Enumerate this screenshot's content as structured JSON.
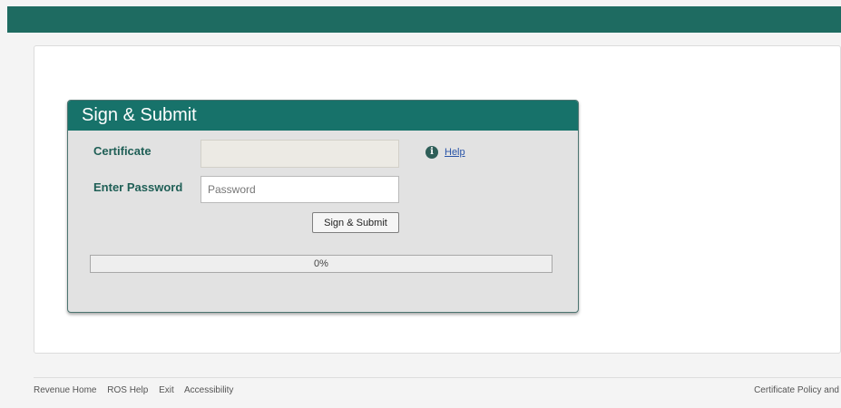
{
  "colors": {
    "header_bar": "#1e6b61",
    "panel_header": "#17726a",
    "label_text": "#1f5f56",
    "link": "#2a55a8"
  },
  "panel": {
    "title": "Sign & Submit",
    "certificate_label": "Certificate",
    "certificate_value": "",
    "password_label": "Enter Password",
    "password_value": "",
    "password_placeholder": "Password",
    "help_icon": "info-circle-icon",
    "help_label": "Help",
    "submit_label": "Sign & Submit",
    "progress_percent": 0,
    "progress_text": "0%"
  },
  "footer": {
    "links": [
      "Revenue Home",
      "ROS Help",
      "Exit",
      "Accessibility"
    ],
    "right_link": "Certificate Policy and"
  }
}
